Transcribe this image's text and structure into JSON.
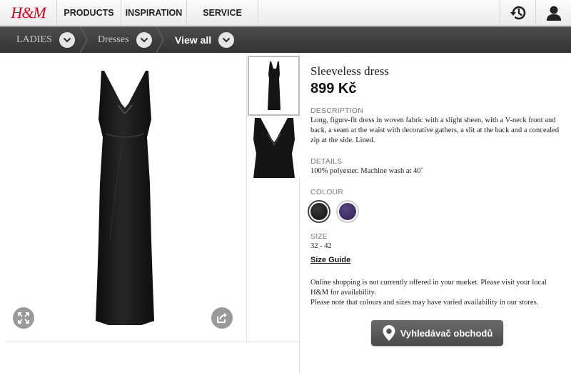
{
  "header": {
    "logo": "H&M",
    "nav": [
      "PRODUCTS",
      "INSPIRATION",
      "SERVICE"
    ],
    "icons": [
      "history-icon",
      "account-icon"
    ]
  },
  "breadcrumb": {
    "items": [
      "LADIES",
      "Dresses",
      "View all"
    ]
  },
  "gallery": {
    "icons": [
      "expand-icon",
      "share-icon"
    ],
    "thumbnail_count": 2
  },
  "product": {
    "name": "Sleeveless dress",
    "price": "899 Kč",
    "description_label": "DESCRIPTION",
    "description": "Long, figure-fit dress in woven fabric with a slight sheen, with a V-neck front and back, a seam at the waist with decorative gathers, a slit at the back and a concealed zip at the side. Lined.",
    "details_label": "DETAILS",
    "details": "100% polyester. Machine wash at 40˚",
    "colour_label": "COLOUR",
    "colours": [
      "#1a1a1a",
      "#3d2a5e"
    ],
    "size_label": "SIZE",
    "sizes": "32 - 42",
    "size_guide": "Size Guide",
    "notice_1": "Online shopping is not currently offered in your market. Please visit your local H&M for availability.",
    "notice_2": "Please note that colours and sizes may have varied availability in our stores.",
    "store_finder_label": "Vyhledávač obchodů",
    "store_finder_icon": "location-pin-icon"
  }
}
